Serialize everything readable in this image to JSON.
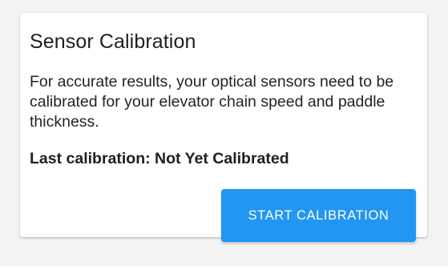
{
  "card": {
    "title": "Sensor Calibration",
    "description": "For accurate results, your optical sensors need to be calibrated for your elevator chain speed and paddle thickness.",
    "last_calibration": "Last calibration: Not Yet Calibrated",
    "start_button_label": "START CALIBRATION"
  },
  "colors": {
    "accent": "#2196f3",
    "background": "#f3f3f3",
    "card": "#ffffff"
  }
}
